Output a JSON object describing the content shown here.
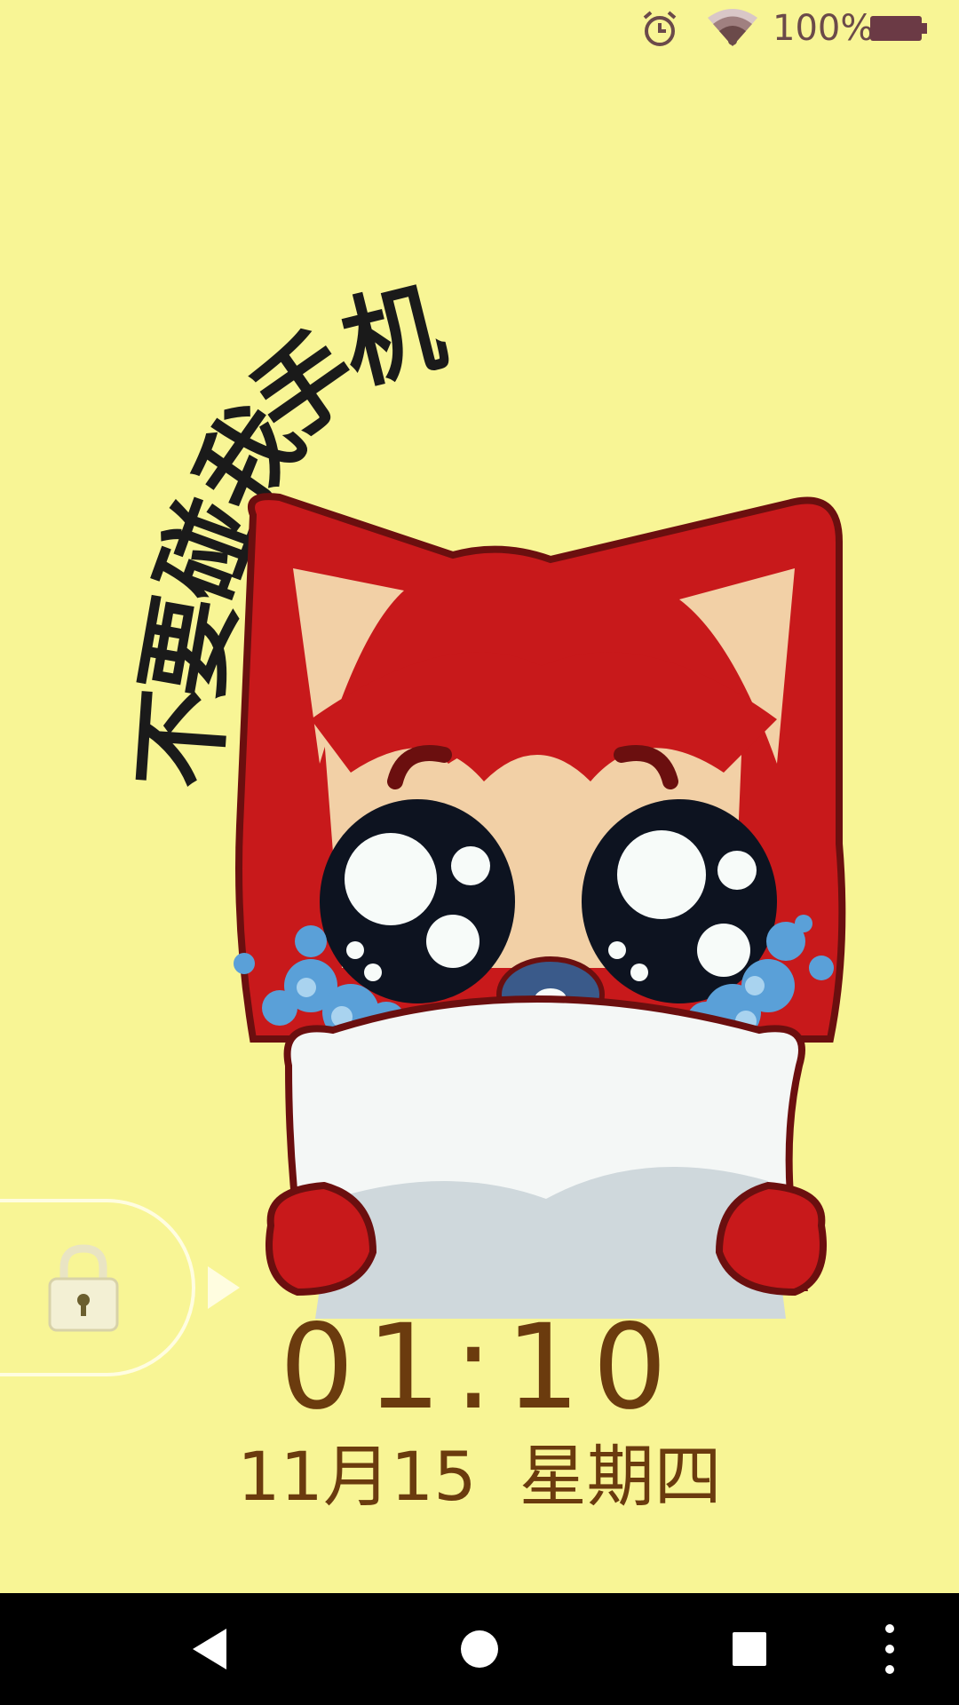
{
  "status_bar": {
    "battery_text": "100%",
    "battery_level": 1.0,
    "icons": [
      "alarm-icon",
      "wifi-icon",
      "battery-icon"
    ]
  },
  "wallpaper": {
    "tagline": "不要碰我手机"
  },
  "lock": {
    "time": "01:10",
    "date": "11月15",
    "weekday": "星期四"
  },
  "navigation": {
    "icons": [
      "back-icon",
      "home-icon",
      "recents-icon",
      "more-icon"
    ]
  },
  "colors": {
    "background": "#f8f595",
    "clock_text": "#6b3b0e",
    "fox_red": "#c8191b",
    "nav_bar": "#000000"
  }
}
